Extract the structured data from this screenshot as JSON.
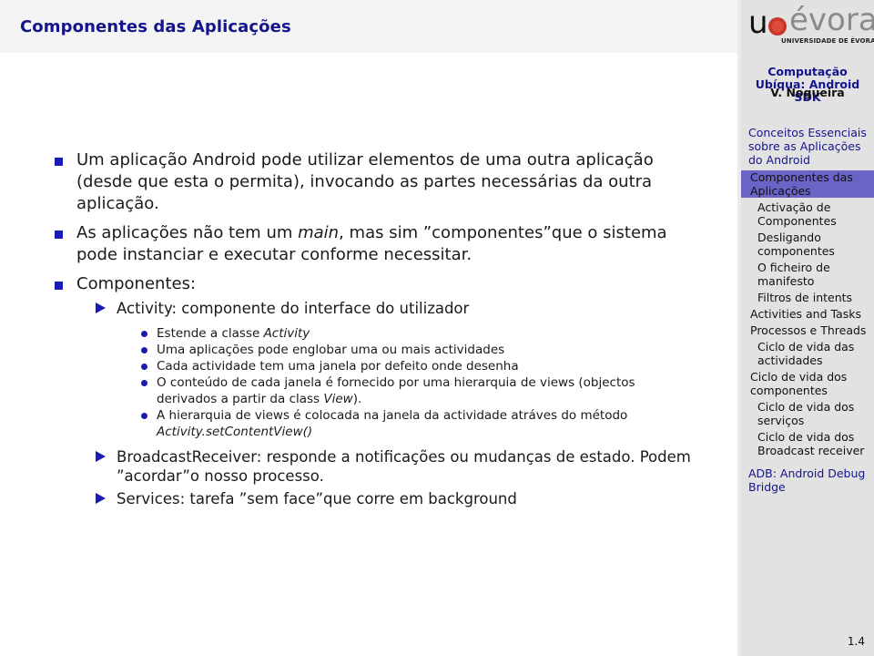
{
  "frame": {
    "title": "Componentes das Aplicações",
    "page_number": "1.4"
  },
  "sidebar": {
    "logo": {
      "letter": "u",
      "name": "évora",
      "subtitle": "UNIVERSIDADE DE ÉVORA"
    },
    "course_title": "Computação Ubíqua: Android SDK",
    "author": "V. Nogueira",
    "nav": [
      {
        "label": "Conceitos Essenciais sobre as Aplicações do Android",
        "level": "section"
      },
      {
        "label": "Componentes das Aplicações",
        "level": "sub",
        "active": true
      },
      {
        "label": "Activação de Componentes",
        "level": "subsub"
      },
      {
        "label": "Desligando componentes",
        "level": "subsub"
      },
      {
        "label": "O ficheiro de manifesto",
        "level": "subsub"
      },
      {
        "label": "Filtros de intents",
        "level": "subsub"
      },
      {
        "label": "Activities and Tasks",
        "level": "sub"
      },
      {
        "label": "Processos e Threads",
        "level": "sub"
      },
      {
        "label": "Ciclo de vida das actividades",
        "level": "subsub"
      },
      {
        "label": "Ciclo de vida dos componentes",
        "level": "sub"
      },
      {
        "label": "Ciclo de vida dos serviços",
        "level": "subsub"
      },
      {
        "label": "Ciclo de vida dos Broadcast receiver",
        "level": "subsub"
      },
      {
        "label": "ADB: Android Debug Bridge",
        "level": "section"
      }
    ]
  },
  "content": {
    "item1": "Um aplicação Android pode utilizar elementos de uma outra aplicação (desde que esta o permita), invocando as partes necessárias da outra aplicação.",
    "item2": {
      "pre": "As aplicações não tem um ",
      "em": "main",
      "post": ", mas sim ”componentes”que o sistema pode instanciar e executar conforme necessitar."
    },
    "item3": "Componentes:",
    "activity": {
      "label": "Activity: componente do interface do utilizador",
      "points": {
        "p1_pre": "Estende a classe ",
        "p1_em": "Activity",
        "p2": "Uma aplicações pode englobar uma ou mais actividades",
        "p3": "Cada actividade tem uma janela por defeito onde desenha",
        "p4_pre": "O conteúdo de cada janela é fornecido por uma hierarquia de views (objectos derivados a partir da class ",
        "p4_em": "View",
        "p4_post": ").",
        "p5_pre": "A hierarquia de views é colocada na janela da actividade atráves do método ",
        "p5_em": "Activity.setContentView()"
      }
    },
    "broadcast": "BroadcastReceiver: responde a notificações ou mudanças de estado. Podem ”acordar”o nosso processo.",
    "services": "Services: tarefa ”sem face”que corre em background"
  },
  "colors": {
    "title": "#14148c",
    "bullet": "#1a1ab4",
    "active_nav": "#6a64c6",
    "sidebar_bg": "#e2e2e2",
    "header_bg": "#f4f4f4"
  }
}
